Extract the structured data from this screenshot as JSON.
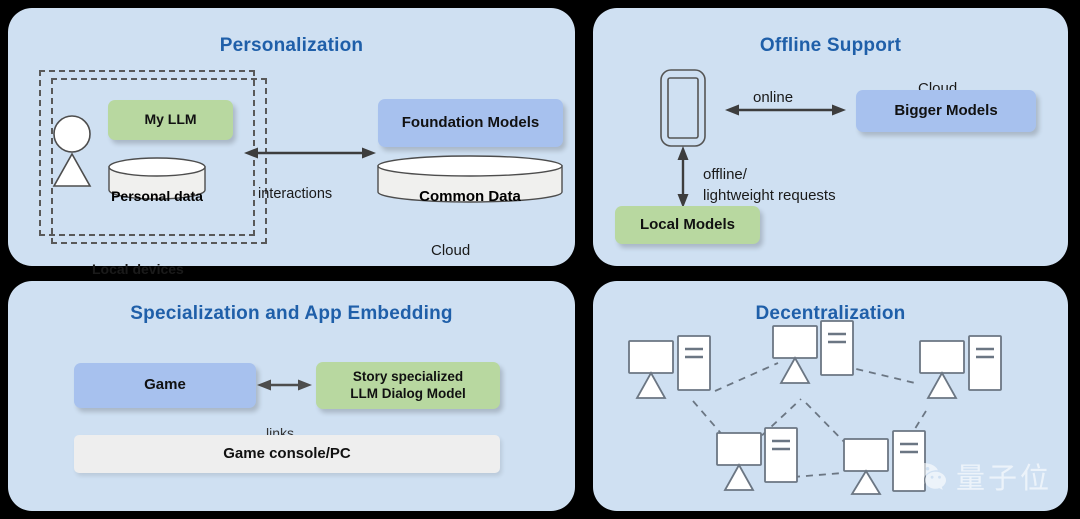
{
  "figure": {
    "background_color": "#000000",
    "panel_color": "#cfe0f2",
    "title_color": "#1f5fa9",
    "accent_green": "#b8d8a0",
    "accent_blue": "#a7c1ee",
    "accent_grey": "#eeeeee",
    "stroke_color": "#595959"
  },
  "panels": {
    "personalization": {
      "title": "Personalization",
      "nodes": {
        "my_llm": "My LLM",
        "personal_data": "Personal data",
        "foundation_models": "Foundation Models",
        "common_data": "Common Data"
      },
      "labels": {
        "interactions": "interactions",
        "local_devices": "Local devices",
        "cloud": "Cloud"
      },
      "icons": {
        "user": "user-icon"
      }
    },
    "offline": {
      "title": "Offline Support",
      "nodes": {
        "bigger_models": "Bigger Models",
        "local_models": "Local Models"
      },
      "labels": {
        "online": "online",
        "offline_requests": "offline/\nlightweight requests",
        "cloud": "Cloud"
      },
      "icons": {
        "phone": "smartphone-icon"
      }
    },
    "specialization": {
      "title": "Specialization and App Embedding",
      "nodes": {
        "game": "Game",
        "story_model": "Story specialized\nLLM Dialog Model",
        "game_console": "Game console/PC"
      },
      "labels": {
        "links": "links"
      }
    },
    "decentralization": {
      "title": "Decentralization",
      "nodes_count": 6,
      "node_icon": "computer-workstation-icon",
      "link_style": "dashed",
      "watermark": {
        "icon": "wechat-icon",
        "text": "量子位"
      }
    }
  }
}
